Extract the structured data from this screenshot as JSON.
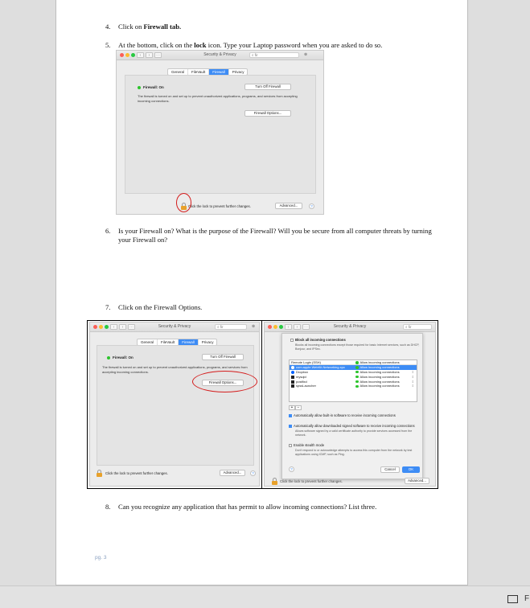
{
  "steps": [
    {
      "num": "4.",
      "pre": "Click on ",
      "bold": "Firewall tab.",
      "post": ""
    },
    {
      "num": "5.",
      "pre": "At the bottom, click on the ",
      "bold": "lock",
      "post": " icon. Type your Laptop password when you are asked to do so."
    },
    {
      "num": "6.",
      "text": "Is your Firewall on? What is the purpose of the Firewall? Will you be secure from all computer threats by turning your Firewall on?"
    },
    {
      "num": "7.",
      "text": "Click on the Firewall Options."
    },
    {
      "num": "8.",
      "text": "Can you recognize any application that has permit to allow incoming connections? List three."
    }
  ],
  "window": {
    "title": "Security & Privacy",
    "search_placeholder": "fir",
    "tabs": [
      "General",
      "FileVault",
      "Firewall",
      "Privacy"
    ],
    "active_tab": "Firewall",
    "firewall_status": "Firewall: On",
    "turn_off_button": "Turn Off Firewall",
    "description": "The firewall is turned on and set up to prevent unauthorized applications, programs, and services from accepting incoming connections.",
    "options_button": "Firewall Options...",
    "lock_text": "Click the lock to prevent further changes.",
    "advanced_button": "Advanced...",
    "help_label": "?"
  },
  "sheet": {
    "block_title": "Block all incoming connections",
    "block_desc": "Blocks all incoming connections except those required for basic Internet services, such as DHCP, Bonjour, and IPSec.",
    "rows": [
      {
        "app": "Remote Login (SSH)",
        "status": "Allow incoming connections"
      },
      {
        "app": "com.apple.WebKit.Networking.xpc",
        "status": "Allow incoming connections"
      },
      {
        "app": "Dropbox",
        "status": "Allow incoming connections"
      },
      {
        "app": "mysqld",
        "status": "Allow incoming connections"
      },
      {
        "app": "postfixd",
        "status": "Allow incoming connections"
      },
      {
        "app": "spssLauncher",
        "status": "Allow incoming connections"
      }
    ],
    "plus": "+",
    "minus": "−",
    "opt_builtin": "Automatically allow built-in software to receive incoming connections",
    "opt_signed": "Automatically allow downloaded signed software to receive incoming connections",
    "opt_signed_desc": "Allows software signed by a valid certificate authority to provide services accessed from the network.",
    "opt_stealth": "Enable stealth mode",
    "opt_stealth_desc": "Don't respond to or acknowledge attempts to access this computer from the network by test applications using ICMP, such as Ping.",
    "cancel_button": "Cancel",
    "ok_button": "OK"
  },
  "footer": {
    "page_label": "pg. 3"
  },
  "statusbar": {
    "label": "F"
  },
  "colors": {
    "accent": "#3d8cf5",
    "annotation": "#d41c1c",
    "status_on": "#2cc42c",
    "lock": "#e8a12a"
  }
}
